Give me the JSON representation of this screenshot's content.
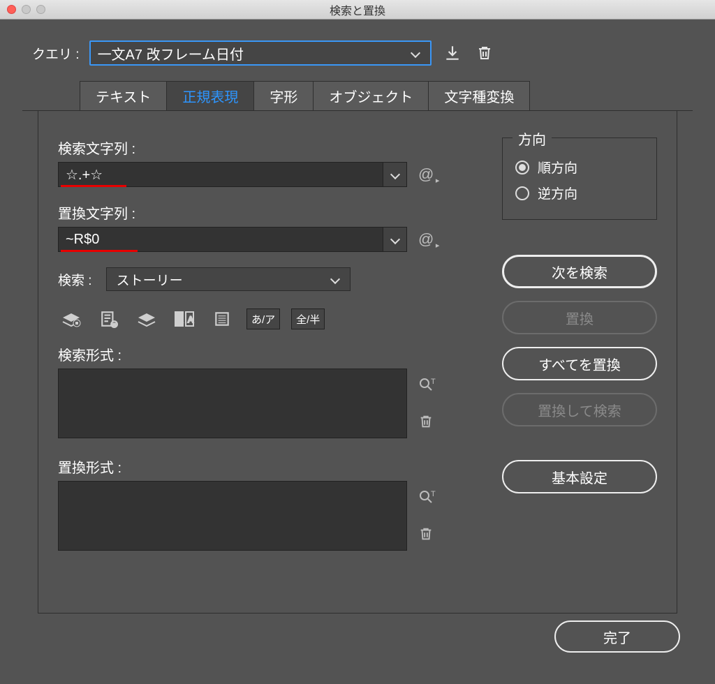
{
  "window": {
    "title": "検索と置換"
  },
  "query": {
    "label": "クエリ :",
    "selected": "一文A7 改フレーム日付"
  },
  "tabs": {
    "text": "テキスト",
    "grep": "正規表現",
    "glyph": "字形",
    "object": "オブジェクト",
    "transliterate": "文字種変換"
  },
  "find": {
    "label": "検索文字列 :",
    "value": "☆.+☆"
  },
  "replace": {
    "label": "置換文字列 :",
    "value": "~R$0"
  },
  "scope": {
    "label": "検索 :",
    "selected": "ストーリー"
  },
  "iconTags": {
    "kana": "あ/ア",
    "width": "全/半"
  },
  "findFormat": {
    "label": "検索形式 :"
  },
  "replaceFormat": {
    "label": "置換形式 :"
  },
  "direction": {
    "legend": "方向",
    "forward": "順方向",
    "backward": "逆方向"
  },
  "buttons": {
    "findNext": "次を検索",
    "change": "置換",
    "changeAll": "すべてを置換",
    "changeFind": "置換して検索",
    "basic": "基本設定",
    "done": "完了"
  }
}
